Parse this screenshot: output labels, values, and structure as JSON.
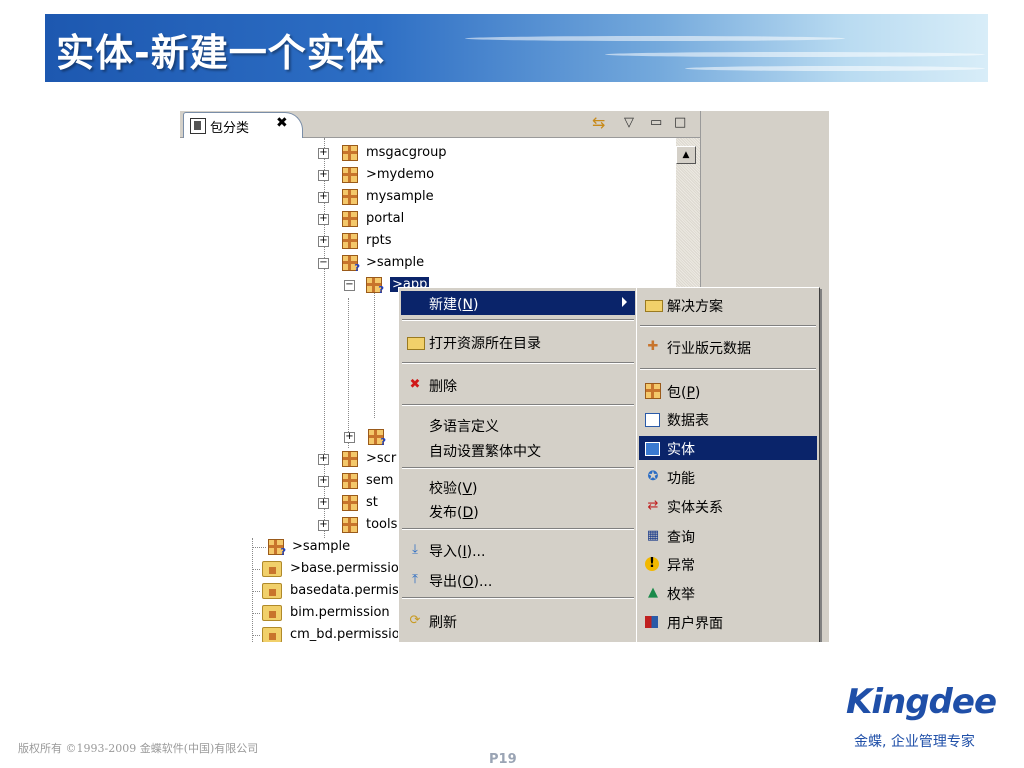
{
  "slide": {
    "title": "实体-新建一个实体",
    "copyright": "版权所有 ©1993-2009 金蝶软件(中国)有限公司",
    "page": "P19",
    "logo": "Kingdee",
    "slogan": "金蝶, 企业管理专家",
    "colors": {
      "banner": "#1d58b0",
      "logo": "#1f4fa8",
      "selection": "#0a246a"
    }
  },
  "view": {
    "tab_label": "包分类",
    "tab_close": "✖",
    "toolbar": {
      "sync": "⇆",
      "menu": "▽",
      "minimize": "▭",
      "maximize": "□"
    },
    "scroll_up": "▲"
  },
  "tree": {
    "nodes": [
      {
        "label": "msgacgroup",
        "expander": "+"
      },
      {
        "label": ">mydemo",
        "expander": "+"
      },
      {
        "label": "mysample",
        "expander": "+"
      },
      {
        "label": "portal",
        "expander": "+"
      },
      {
        "label": "rpts",
        "expander": "+"
      },
      {
        "label": ">sample",
        "expander": "−"
      },
      {
        "label": ">app",
        "expander": "−"
      },
      {
        "label": ">scr",
        "expander": "+"
      },
      {
        "label": "sem",
        "expander": "+"
      },
      {
        "label": "st",
        "expander": "+"
      },
      {
        "label": "tools",
        "expander": "+"
      },
      {
        "label": ">sample"
      },
      {
        "label": ">base.permissio"
      },
      {
        "label": "basedata.permis"
      },
      {
        "label": "bim.permission"
      },
      {
        "label": "cm_bd.permissio"
      }
    ]
  },
  "context_menu": {
    "new": {
      "label": "新建",
      "mnemonic": "N"
    },
    "open_dir": "打开资源所在目录",
    "delete": "删除",
    "multilang": "多语言定义",
    "auto_trad": "自动设置繁体中文",
    "verify": {
      "label": "校验",
      "mnemonic": "V"
    },
    "publish": {
      "label": "发布",
      "mnemonic": "D"
    },
    "import": {
      "label": "导入",
      "mnemonic": "I",
      "suffix": "..."
    },
    "export": {
      "label": "导出",
      "mnemonic": "O",
      "suffix": "..."
    },
    "refresh": "刷新"
  },
  "submenu": {
    "solution": "解决方案",
    "industry": "行业版元数据",
    "package": {
      "label": "包",
      "mnemonic": "P"
    },
    "table": "数据表",
    "entity": "实体",
    "function": "功能",
    "relation": "实体关系",
    "query": "查询",
    "exception": "异常",
    "enum": "枚举",
    "ui": "用户界面"
  }
}
